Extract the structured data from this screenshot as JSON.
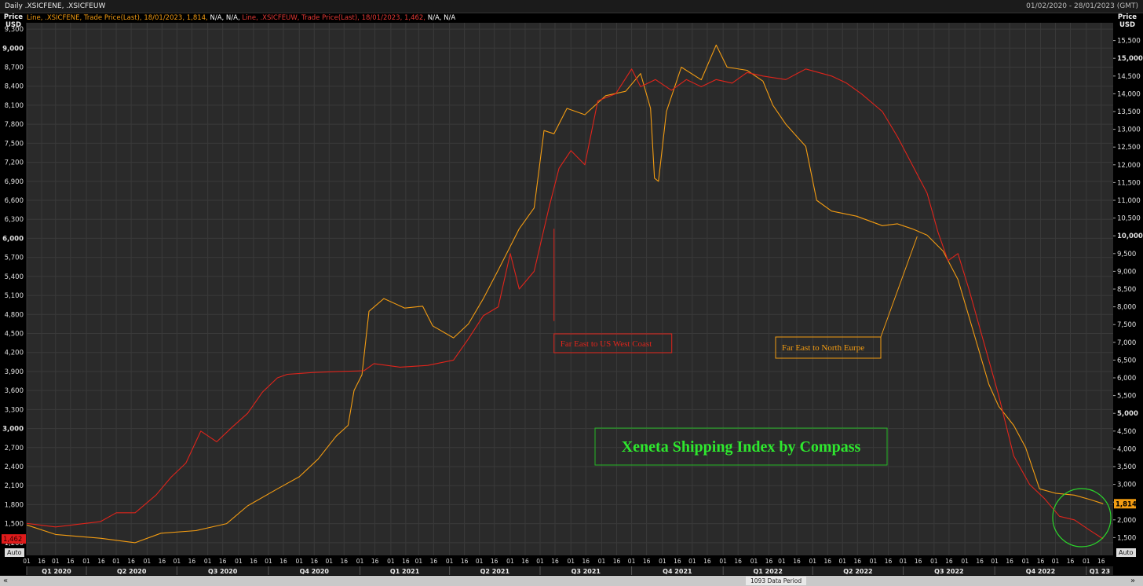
{
  "header": {
    "title": "Daily .XSICFENE, .XSICFEUW",
    "date_range": "01/02/2020 - 28/01/2023 (GMT)"
  },
  "legend": {
    "part1": "Line, .XSICFENE, Trade Price(Last), 18/01/2023, 1,814,",
    "part2": "N/A, N/A,",
    "part3": "Line, .XSICFEUW, Trade Price(Last), 18/01/2023, 1,462,",
    "part4": "N/A, N/A"
  },
  "axes": {
    "left_title_1": "Price",
    "left_title_2": "USD",
    "right_title_1": "Price",
    "right_title_2": "USD",
    "auto_left": "Auto",
    "auto_right": "Auto"
  },
  "footer": {
    "data_period": "1093 Data Period",
    "prev": "«",
    "next": "»"
  },
  "colors": {
    "north_europe": "#f39c12",
    "us_west_coast": "#e0241b",
    "xeneta_text": "#2ee82e",
    "circle": "#2bd62b",
    "background": "#2a2a2a",
    "grid": "#3a3a3a"
  },
  "chart_data": {
    "type": "line",
    "title": "Xeneta Shipping Index by Compass",
    "left_axis": {
      "ylim": [
        1000,
        9400
      ],
      "ticks": [
        1200,
        1500,
        1800,
        2100,
        2400,
        2700,
        3000,
        3300,
        3600,
        3900,
        4200,
        4500,
        4800,
        5100,
        5400,
        5700,
        6000,
        6300,
        6600,
        6900,
        7200,
        7500,
        7800,
        8100,
        8400,
        8700,
        9000,
        9300
      ],
      "tick_labels": [
        "1,200",
        "1,500",
        "1,800",
        "2,100",
        "2,400",
        "2,700",
        "3,000",
        "3,300",
        "3,600",
        "3,900",
        "4,200",
        "4,500",
        "4,800",
        "5,100",
        "5,400",
        "5,700",
        "6,000",
        "6,300",
        "6,600",
        "6,900",
        "7,200",
        "7,500",
        "7,800",
        "8,100",
        "8,400",
        "8,700",
        "9,000",
        "9,300"
      ]
    },
    "right_axis": {
      "ylim": [
        1000,
        16000
      ],
      "ticks": [
        1500,
        2000,
        2500,
        3000,
        3500,
        4000,
        4500,
        5000,
        5500,
        6000,
        6500,
        7000,
        7500,
        8000,
        8500,
        9000,
        9500,
        10000,
        10500,
        11000,
        11500,
        12000,
        12500,
        13000,
        13500,
        14000,
        14500,
        15000,
        15500
      ],
      "tick_labels": [
        "1,500",
        "2,000",
        "2,500",
        "3,000",
        "3,500",
        "4,000",
        "4,500",
        "5,000",
        "5,500",
        "6,000",
        "6,500",
        "7,000",
        "7,500",
        "8,000",
        "8,500",
        "9,000",
        "9,500",
        "10,000",
        "10,500",
        "11,000",
        "11,500",
        "12,000",
        "12,500",
        "13,000",
        "13,500",
        "14,000",
        "14,500",
        "15,000",
        "15,500"
      ]
    },
    "xlim": [
      "2020-02-01",
      "2023-01-28"
    ],
    "quarters": [
      {
        "label": "Q1 2020",
        "date": "2020-01-01"
      },
      {
        "label": "Q2 2020",
        "date": "2020-04-01"
      },
      {
        "label": "Q3 2020",
        "date": "2020-07-01"
      },
      {
        "label": "Q4 2020",
        "date": "2020-10-01"
      },
      {
        "label": "Q1 2021",
        "date": "2021-01-01"
      },
      {
        "label": "Q2 2021",
        "date": "2021-04-01"
      },
      {
        "label": "Q3 2021",
        "date": "2021-07-01"
      },
      {
        "label": "Q4 2021",
        "date": "2021-10-01"
      },
      {
        "label": "Q1 2022",
        "date": "2022-01-01"
      },
      {
        "label": "Q2 2022",
        "date": "2022-04-01"
      },
      {
        "label": "Q3 2022",
        "date": "2022-07-01"
      },
      {
        "label": "Q4 2022",
        "date": "2022-10-01"
      },
      {
        "label": "Q1 23",
        "date": "2023-01-01"
      }
    ],
    "day_tick_labels": [
      "01",
      "16"
    ],
    "series": [
      {
        "name": ".XSICFENE",
        "label": "Far East to North Eurpe",
        "axis": "left",
        "color": "#f39c12",
        "last": "1,814",
        "points": [
          [
            "2020-02-01",
            1480
          ],
          [
            "2020-03-01",
            1330
          ],
          [
            "2020-04-15",
            1270
          ],
          [
            "2020-05-20",
            1200
          ],
          [
            "2020-06-15",
            1350
          ],
          [
            "2020-07-20",
            1390
          ],
          [
            "2020-08-20",
            1500
          ],
          [
            "2020-09-10",
            1780
          ],
          [
            "2020-10-10",
            2050
          ],
          [
            "2020-11-01",
            2240
          ],
          [
            "2020-11-20",
            2520
          ],
          [
            "2020-12-08",
            2880
          ],
          [
            "2020-12-20",
            3050
          ],
          [
            "2020-12-26",
            3600
          ],
          [
            "2021-01-03",
            3850
          ],
          [
            "2021-01-10",
            4850
          ],
          [
            "2021-01-25",
            5050
          ],
          [
            "2021-02-15",
            4900
          ],
          [
            "2021-03-05",
            4930
          ],
          [
            "2021-03-15",
            4620
          ],
          [
            "2021-04-05",
            4430
          ],
          [
            "2021-04-20",
            4650
          ],
          [
            "2021-05-05",
            5050
          ],
          [
            "2021-05-20",
            5500
          ],
          [
            "2021-06-10",
            6150
          ],
          [
            "2021-06-25",
            6480
          ],
          [
            "2021-07-05",
            7700
          ],
          [
            "2021-07-15",
            7650
          ],
          [
            "2021-07-28",
            8050
          ],
          [
            "2021-08-15",
            7950
          ],
          [
            "2021-09-05",
            8250
          ],
          [
            "2021-09-25",
            8320
          ],
          [
            "2021-10-10",
            8600
          ],
          [
            "2021-10-20",
            8050
          ],
          [
            "2021-10-24",
            6950
          ],
          [
            "2021-10-28",
            6900
          ],
          [
            "2021-11-05",
            8000
          ],
          [
            "2021-11-20",
            8700
          ],
          [
            "2021-12-10",
            8500
          ],
          [
            "2021-12-25",
            9050
          ],
          [
            "2022-01-05",
            8700
          ],
          [
            "2022-01-25",
            8650
          ],
          [
            "2022-02-10",
            8480
          ],
          [
            "2022-02-20",
            8100
          ],
          [
            "2022-03-05",
            7800
          ],
          [
            "2022-03-25",
            7450
          ],
          [
            "2022-04-05",
            6600
          ],
          [
            "2022-04-20",
            6430
          ],
          [
            "2022-05-15",
            6350
          ],
          [
            "2022-06-10",
            6200
          ],
          [
            "2022-06-25",
            6230
          ],
          [
            "2022-07-10",
            6150
          ],
          [
            "2022-07-25",
            6050
          ],
          [
            "2022-08-10",
            5800
          ],
          [
            "2022-08-25",
            5350
          ],
          [
            "2022-09-10",
            4500
          ],
          [
            "2022-09-25",
            3700
          ],
          [
            "2022-10-05",
            3350
          ],
          [
            "2022-10-20",
            3050
          ],
          [
            "2022-11-01",
            2700
          ],
          [
            "2022-11-15",
            2050
          ],
          [
            "2022-12-01",
            1980
          ],
          [
            "2022-12-20",
            1950
          ],
          [
            "2023-01-05",
            1880
          ],
          [
            "2023-01-18",
            1814
          ]
        ]
      },
      {
        "name": ".XSICFEUW",
        "label": "Far East to US West Coast",
        "axis": "right",
        "color": "#e0241b",
        "last": "1,462",
        "points": [
          [
            "2020-02-01",
            1900
          ],
          [
            "2020-03-01",
            1800
          ],
          [
            "2020-04-15",
            1950
          ],
          [
            "2020-05-01",
            2200
          ],
          [
            "2020-05-20",
            2200
          ],
          [
            "2020-06-10",
            2700
          ],
          [
            "2020-06-25",
            3200
          ],
          [
            "2020-07-10",
            3600
          ],
          [
            "2020-07-25",
            4500
          ],
          [
            "2020-08-10",
            4200
          ],
          [
            "2020-08-25",
            4600
          ],
          [
            "2020-09-10",
            5000
          ],
          [
            "2020-09-25",
            5600
          ],
          [
            "2020-10-10",
            6000
          ],
          [
            "2020-10-20",
            6100
          ],
          [
            "2020-11-15",
            6150
          ],
          [
            "2020-12-10",
            6180
          ],
          [
            "2021-01-05",
            6200
          ],
          [
            "2021-01-15",
            6400
          ],
          [
            "2021-02-10",
            6300
          ],
          [
            "2021-03-10",
            6350
          ],
          [
            "2021-04-05",
            6500
          ],
          [
            "2021-04-20",
            7100
          ],
          [
            "2021-05-05",
            7750
          ],
          [
            "2021-05-20",
            8000
          ],
          [
            "2021-06-01",
            9500
          ],
          [
            "2021-06-10",
            8500
          ],
          [
            "2021-06-25",
            9000
          ],
          [
            "2021-07-10",
            10800
          ],
          [
            "2021-07-20",
            11900
          ],
          [
            "2021-08-01",
            12400
          ],
          [
            "2021-08-15",
            12000
          ],
          [
            "2021-08-28",
            13800
          ],
          [
            "2021-09-15",
            14000
          ],
          [
            "2021-10-01",
            14700
          ],
          [
            "2021-10-10",
            14200
          ],
          [
            "2021-10-25",
            14400
          ],
          [
            "2021-11-10",
            14100
          ],
          [
            "2021-11-25",
            14400
          ],
          [
            "2021-12-10",
            14200
          ],
          [
            "2021-12-25",
            14400
          ],
          [
            "2022-01-10",
            14300
          ],
          [
            "2022-01-25",
            14600
          ],
          [
            "2022-02-10",
            14500
          ],
          [
            "2022-03-05",
            14400
          ],
          [
            "2022-03-25",
            14700
          ],
          [
            "2022-04-20",
            14500
          ],
          [
            "2022-05-05",
            14300
          ],
          [
            "2022-05-20",
            14000
          ],
          [
            "2022-06-10",
            13500
          ],
          [
            "2022-06-25",
            12800
          ],
          [
            "2022-07-10",
            12000
          ],
          [
            "2022-07-25",
            11200
          ],
          [
            "2022-08-05",
            10100
          ],
          [
            "2022-08-15",
            9300
          ],
          [
            "2022-08-25",
            9500
          ],
          [
            "2022-09-05",
            8500
          ],
          [
            "2022-09-20",
            7000
          ],
          [
            "2022-10-05",
            5500
          ],
          [
            "2022-10-20",
            3800
          ],
          [
            "2022-11-05",
            3000
          ],
          [
            "2022-11-20",
            2600
          ],
          [
            "2022-12-05",
            2100
          ],
          [
            "2022-12-20",
            2000
          ],
          [
            "2023-01-05",
            1700
          ],
          [
            "2023-01-18",
            1462
          ]
        ]
      }
    ]
  }
}
